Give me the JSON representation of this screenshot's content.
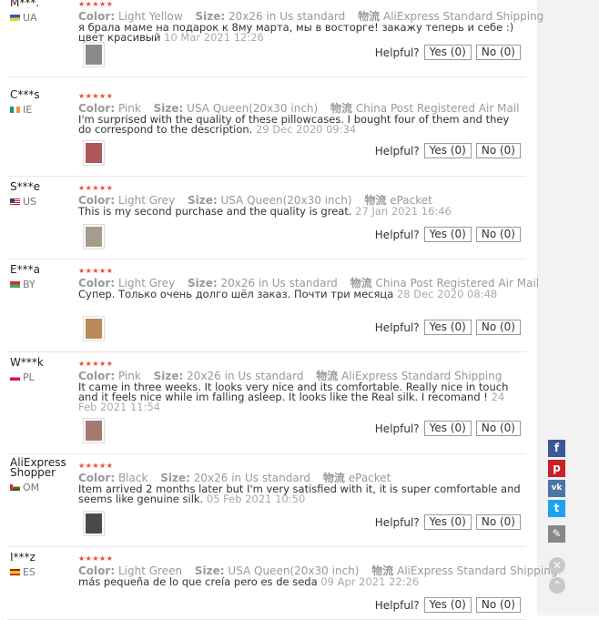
{
  "labels": {
    "color": "Color:",
    "size": "Size:",
    "shipping": "物流",
    "helpful": "Helpful?",
    "stars": "★★★★★"
  },
  "reviews": [
    {
      "user": "M***.",
      "country": "UA",
      "color": "Light Yellow",
      "size": "20x26 in Us standard",
      "shipping": "AliExpress Standard Shipping",
      "text": "я брала маме на подарок к 8му марта, мы в восторге! закажу теперь и себе :) цвет красивый",
      "date": "10 Mar 2021 12:26",
      "yes": "Yes (0)",
      "no": "No (0)",
      "thumb": "#8a8a8a"
    },
    {
      "user": "C***s",
      "country": "IE",
      "color": "Pink",
      "size": "USA Queen(20x30 inch)",
      "shipping": "China Post Registered Air Mail",
      "text": "I'm surprised with the quality of these pillowcases. I bought four of them and they do correspond to the description.",
      "date": "29 Dec 2020 09:34",
      "yes": "Yes (0)",
      "no": "No (0)",
      "thumb": "#b0575c"
    },
    {
      "user": "S***e",
      "country": "US",
      "color": "Light Grey",
      "size": "USA Queen(20x30 inch)",
      "shipping": "ePacket",
      "text": "This is my second purchase and the quality is great.",
      "date": "27 Jan 2021 16:46",
      "yes": "Yes (0)",
      "no": "No (0)",
      "thumb": "#a79c8c"
    },
    {
      "user": "E***a",
      "country": "BY",
      "color": "Light Grey",
      "size": "20x26 in Us standard",
      "shipping": "China Post Registered Air Mail",
      "text": "Супер. Только очень долго шёл заказ. Почти три месяца",
      "date": "28 Dec 2020 08:48",
      "yes": "Yes (0)",
      "no": "No (0)",
      "thumb": "#b88a5a"
    },
    {
      "user": "W***k",
      "country": "PL",
      "color": "Pink",
      "size": "20x26 in Us standard",
      "shipping": "AliExpress Standard Shipping",
      "text": "It came in three weeks. It looks very nice and its comfortable. Really nice in touch and it feels nice while im falling asleep. It looks like the Real silk. I recomand !",
      "date": "24 Feb 2021 11:54",
      "yes": "Yes (0)",
      "no": "No (0)",
      "thumb": "#a57a70"
    },
    {
      "user": "AliExpress Shopper",
      "country": "OM",
      "color": "Black",
      "size": "20x26 in Us standard",
      "shipping": "ePacket",
      "text": "Item arrived 2 months later but I'm very satisfied with it, it is super comfortable and seems like genuine silk.",
      "date": "05 Feb 2021 10:50",
      "yes": "Yes (0)",
      "no": "No (0)",
      "thumb": "#4a4a4a"
    },
    {
      "user": "I***z",
      "country": "ES",
      "color": "Light Green",
      "size": "USA Queen(20x30 inch)",
      "shipping": "AliExpress Standard Shipping",
      "text": "más pequeña de lo que creía pero es de seda",
      "date": "09 Apr 2021 22:26",
      "yes": "Yes (0)",
      "no": "No (0)",
      "thumb": ""
    }
  ],
  "share": {
    "facebook": "f",
    "pinterest": "p",
    "vk": "vk",
    "twitter": "t",
    "edit": "✎",
    "close": "✕",
    "up": "⌃"
  }
}
